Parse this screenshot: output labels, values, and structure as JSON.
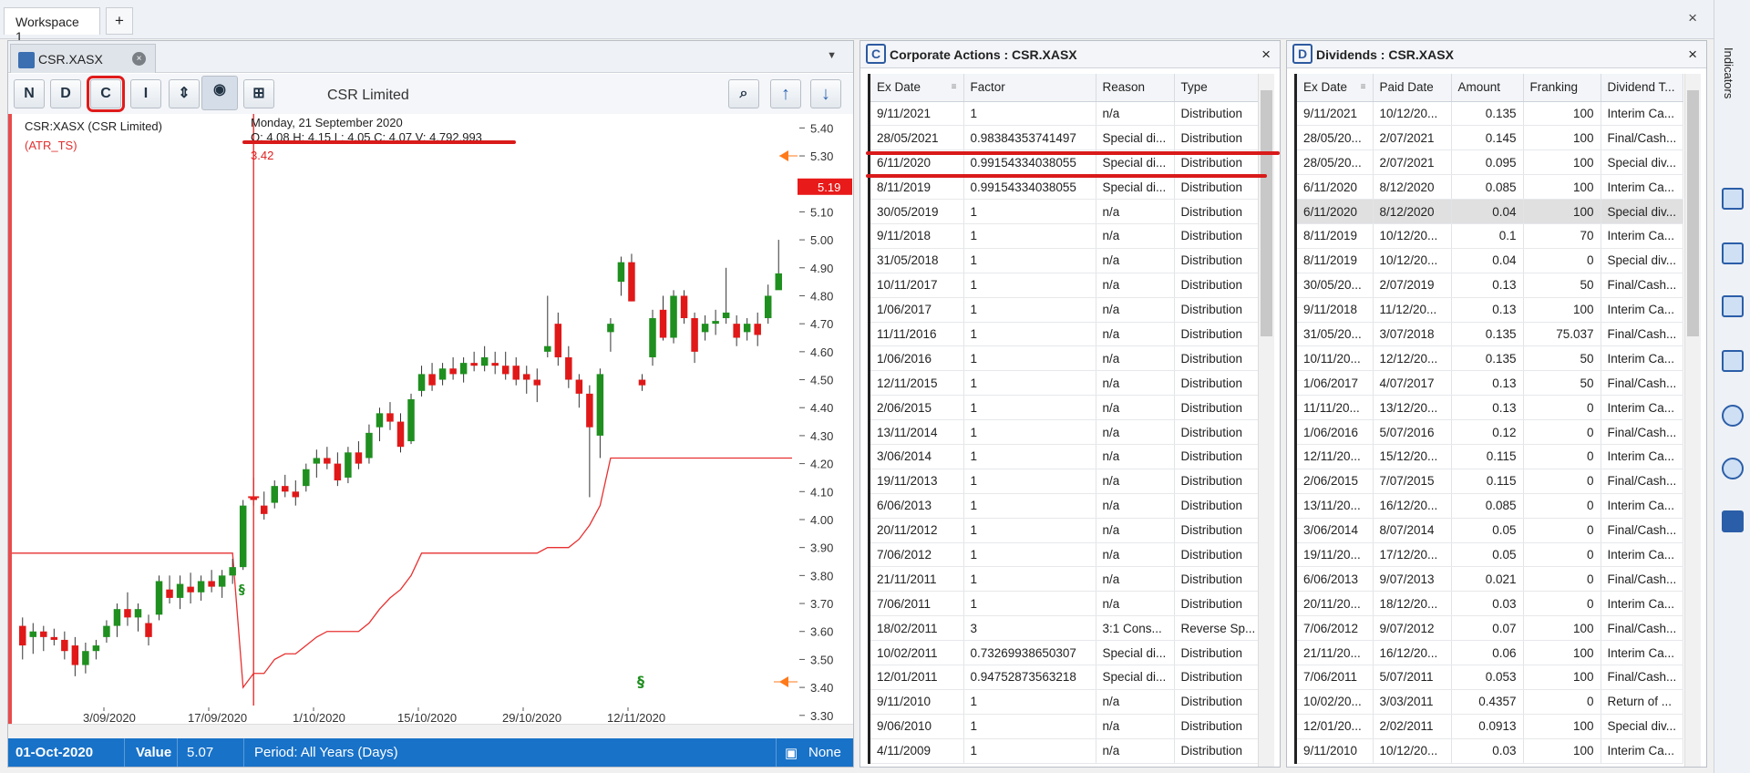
{
  "workspace": {
    "tab": "Workspace 1",
    "add": "+",
    "close": "×"
  },
  "chart": {
    "tab": "CSR.XASX",
    "tab_close": "×",
    "toolbar": {
      "n": "N",
      "d": "D",
      "c": "C",
      "i": "I"
    },
    "security_name": "CSR Limited",
    "legend_symbol": "CSR:XASX (CSR Limited)",
    "legend_indicator": "(ATR_TS)",
    "crosshair_date": "Monday, 21 September 2020",
    "crosshair_ohlc": "O: 4.08  H: 4.15  L: 4.05  C: 4.07  V: 4,792,993",
    "crosshair_value": "3.42",
    "last_price": "5.19",
    "status": {
      "date": "01-Oct-2020",
      "value_label": "Value",
      "value": "5.07",
      "period": "Period: All Years (Days)",
      "none": "None"
    }
  },
  "chart_data": {
    "type": "candlestick",
    "y_ticks": [
      "5.40",
      "5.30",
      "5.20",
      "5.10",
      "5.00",
      "4.90",
      "4.80",
      "4.70",
      "4.60",
      "4.50",
      "4.40",
      "4.30",
      "4.20",
      "4.10",
      "4.00",
      "3.90",
      "3.80",
      "3.70",
      "3.60",
      "3.50",
      "3.40",
      "3.30"
    ],
    "x_ticks": [
      "3/09/2020",
      "17/09/2020",
      "1/10/2020",
      "15/10/2020",
      "29/10/2020",
      "12/11/2020"
    ],
    "ylim": [
      3.27,
      5.45
    ],
    "candles": [
      [
        3.62,
        3.65,
        3.5,
        3.55
      ],
      [
        3.58,
        3.63,
        3.52,
        3.6
      ],
      [
        3.6,
        3.62,
        3.53,
        3.58
      ],
      [
        3.58,
        3.61,
        3.55,
        3.57
      ],
      [
        3.57,
        3.6,
        3.5,
        3.53
      ],
      [
        3.55,
        3.58,
        3.44,
        3.48
      ],
      [
        3.48,
        3.56,
        3.45,
        3.53
      ],
      [
        3.53,
        3.57,
        3.5,
        3.55
      ],
      [
        3.58,
        3.64,
        3.56,
        3.62
      ],
      [
        3.62,
        3.7,
        3.58,
        3.68
      ],
      [
        3.68,
        3.74,
        3.62,
        3.65
      ],
      [
        3.65,
        3.7,
        3.6,
        3.68
      ],
      [
        3.63,
        3.66,
        3.55,
        3.58
      ],
      [
        3.66,
        3.8,
        3.64,
        3.78
      ],
      [
        3.75,
        3.8,
        3.7,
        3.72
      ],
      [
        3.72,
        3.8,
        3.68,
        3.77
      ],
      [
        3.76,
        3.81,
        3.7,
        3.74
      ],
      [
        3.74,
        3.8,
        3.71,
        3.78
      ],
      [
        3.78,
        3.82,
        3.74,
        3.76
      ],
      [
        3.76,
        3.82,
        3.72,
        3.8
      ],
      [
        3.8,
        3.86,
        3.77,
        3.83
      ],
      [
        3.83,
        4.07,
        3.82,
        4.05
      ],
      [
        4.08,
        4.15,
        4.05,
        4.07
      ],
      [
        4.05,
        4.1,
        4.0,
        4.02
      ],
      [
        4.06,
        4.14,
        4.04,
        4.12
      ],
      [
        4.12,
        4.16,
        4.08,
        4.1
      ],
      [
        4.1,
        4.14,
        4.05,
        4.08
      ],
      [
        4.12,
        4.2,
        4.1,
        4.18
      ],
      [
        4.2,
        4.25,
        4.15,
        4.22
      ],
      [
        4.22,
        4.26,
        4.18,
        4.2
      ],
      [
        4.2,
        4.24,
        4.12,
        4.14
      ],
      [
        4.15,
        4.26,
        4.13,
        4.24
      ],
      [
        4.24,
        4.28,
        4.18,
        4.2
      ],
      [
        4.22,
        4.34,
        4.2,
        4.31
      ],
      [
        4.33,
        4.4,
        4.28,
        4.38
      ],
      [
        4.38,
        4.42,
        4.32,
        4.35
      ],
      [
        4.35,
        4.38,
        4.24,
        4.26
      ],
      [
        4.28,
        4.45,
        4.27,
        4.43
      ],
      [
        4.46,
        4.55,
        4.44,
        4.52
      ],
      [
        4.52,
        4.56,
        4.46,
        4.48
      ],
      [
        4.5,
        4.56,
        4.48,
        4.54
      ],
      [
        4.54,
        4.58,
        4.5,
        4.52
      ],
      [
        4.52,
        4.58,
        4.49,
        4.56
      ],
      [
        4.56,
        4.6,
        4.53,
        4.55
      ],
      [
        4.55,
        4.62,
        4.53,
        4.58
      ],
      [
        4.56,
        4.6,
        4.52,
        4.55
      ],
      [
        4.55,
        4.6,
        4.5,
        4.52
      ],
      [
        4.55,
        4.58,
        4.48,
        4.5
      ],
      [
        4.52,
        4.55,
        4.45,
        4.5
      ],
      [
        4.5,
        4.54,
        4.42,
        4.48
      ],
      [
        4.6,
        4.8,
        4.58,
        4.62
      ],
      [
        4.7,
        4.74,
        4.55,
        4.58
      ],
      [
        4.58,
        4.62,
        4.47,
        4.5
      ],
      [
        4.5,
        4.52,
        4.4,
        4.45
      ],
      [
        4.45,
        4.48,
        4.08,
        4.33
      ],
      [
        4.3,
        4.54,
        4.22,
        4.52
      ],
      [
        4.67,
        4.72,
        4.6,
        4.7
      ],
      [
        4.85,
        4.94,
        4.8,
        4.92
      ],
      [
        4.92,
        4.95,
        4.78,
        4.78
      ],
      [
        4.5,
        4.52,
        4.46,
        4.48
      ],
      [
        4.58,
        4.75,
        4.55,
        4.72
      ],
      [
        4.75,
        4.8,
        4.64,
        4.65
      ],
      [
        4.65,
        4.82,
        4.63,
        4.8
      ],
      [
        4.8,
        4.82,
        4.7,
        4.72
      ],
      [
        4.72,
        4.74,
        4.56,
        4.6
      ],
      [
        4.67,
        4.73,
        4.64,
        4.7
      ],
      [
        4.7,
        4.75,
        4.66,
        4.71
      ],
      [
        4.72,
        4.9,
        4.7,
        4.74
      ],
      [
        4.7,
        4.73,
        4.62,
        4.65
      ],
      [
        4.67,
        4.72,
        4.64,
        4.7
      ],
      [
        4.7,
        4.74,
        4.62,
        4.66
      ],
      [
        4.72,
        4.84,
        4.7,
        4.8
      ],
      [
        4.82,
        5.0,
        4.84,
        4.88
      ]
    ],
    "atr_ts": [
      3.88,
      3.88,
      3.88,
      3.88,
      3.88,
      3.88,
      3.88,
      3.88,
      3.88,
      3.88,
      3.88,
      3.88,
      3.88,
      3.88,
      3.88,
      3.88,
      3.88,
      3.88,
      3.88,
      3.88,
      3.88,
      3.4,
      3.45,
      3.45,
      3.5,
      3.52,
      3.52,
      3.55,
      3.58,
      3.6,
      3.6,
      3.6,
      3.6,
      3.63,
      3.68,
      3.72,
      3.75,
      3.8,
      3.88,
      3.88,
      3.88,
      3.88,
      3.88,
      3.88,
      3.88,
      3.88,
      3.88,
      3.88,
      3.88,
      3.88,
      3.9,
      3.9,
      3.9,
      3.93,
      3.98,
      4.05,
      4.22,
      4.22,
      4.22,
      4.22,
      4.22,
      4.22,
      4.22,
      4.22,
      4.22,
      4.22,
      4.22,
      4.22,
      4.22,
      4.22,
      4.22,
      4.22,
      4.22
    ]
  },
  "corp_actions": {
    "title": "Corporate Actions : CSR.XASX",
    "close": "×",
    "columns": [
      "Ex Date",
      "Factor",
      "Reason",
      "Type"
    ],
    "rows": [
      [
        "9/11/2021",
        "1",
        "n/a",
        "Distribution"
      ],
      [
        "28/05/2021",
        "0.98384353741497",
        "Special di...",
        "Distribution"
      ],
      [
        "6/11/2020",
        "0.99154334038055",
        "Special di...",
        "Distribution"
      ],
      [
        "8/11/2019",
        "0.99154334038055",
        "Special di...",
        "Distribution"
      ],
      [
        "30/05/2019",
        "1",
        "n/a",
        "Distribution"
      ],
      [
        "9/11/2018",
        "1",
        "n/a",
        "Distribution"
      ],
      [
        "31/05/2018",
        "1",
        "n/a",
        "Distribution"
      ],
      [
        "10/11/2017",
        "1",
        "n/a",
        "Distribution"
      ],
      [
        "1/06/2017",
        "1",
        "n/a",
        "Distribution"
      ],
      [
        "11/11/2016",
        "1",
        "n/a",
        "Distribution"
      ],
      [
        "1/06/2016",
        "1",
        "n/a",
        "Distribution"
      ],
      [
        "12/11/2015",
        "1",
        "n/a",
        "Distribution"
      ],
      [
        "2/06/2015",
        "1",
        "n/a",
        "Distribution"
      ],
      [
        "13/11/2014",
        "1",
        "n/a",
        "Distribution"
      ],
      [
        "3/06/2014",
        "1",
        "n/a",
        "Distribution"
      ],
      [
        "19/11/2013",
        "1",
        "n/a",
        "Distribution"
      ],
      [
        "6/06/2013",
        "1",
        "n/a",
        "Distribution"
      ],
      [
        "20/11/2012",
        "1",
        "n/a",
        "Distribution"
      ],
      [
        "7/06/2012",
        "1",
        "n/a",
        "Distribution"
      ],
      [
        "21/11/2011",
        "1",
        "n/a",
        "Distribution"
      ],
      [
        "7/06/2011",
        "1",
        "n/a",
        "Distribution"
      ],
      [
        "18/02/2011",
        "3",
        "3:1 Cons...",
        "Reverse Sp..."
      ],
      [
        "10/02/2011",
        "0.73269938650307",
        "Special di...",
        "Distribution"
      ],
      [
        "12/01/2011",
        "0.94752873563218",
        "Special di...",
        "Distribution"
      ],
      [
        "9/11/2010",
        "1",
        "n/a",
        "Distribution"
      ],
      [
        "9/06/2010",
        "1",
        "n/a",
        "Distribution"
      ],
      [
        "4/11/2009",
        "1",
        "n/a",
        "Distribution"
      ]
    ]
  },
  "dividends": {
    "title": "Dividends : CSR.XASX",
    "close": "×",
    "columns": [
      "Ex Date",
      "Paid Date",
      "Amount",
      "Franking",
      "Dividend T..."
    ],
    "rows": [
      [
        "9/11/2021",
        "10/12/20...",
        "0.135",
        "100",
        "Interim Ca..."
      ],
      [
        "28/05/20...",
        "2/07/2021",
        "0.145",
        "100",
        "Final/Cash..."
      ],
      [
        "28/05/20...",
        "2/07/2021",
        "0.095",
        "100",
        "Special div..."
      ],
      [
        "6/11/2020",
        "8/12/2020",
        "0.085",
        "100",
        "Interim Ca..."
      ],
      [
        "6/11/2020",
        "8/12/2020",
        "0.04",
        "100",
        "Special div..."
      ],
      [
        "8/11/2019",
        "10/12/20...",
        "0.1",
        "70",
        "Interim Ca..."
      ],
      [
        "8/11/2019",
        "10/12/20...",
        "0.04",
        "0",
        "Special div..."
      ],
      [
        "30/05/20...",
        "2/07/2019",
        "0.13",
        "50",
        "Final/Cash..."
      ],
      [
        "9/11/2018",
        "11/12/20...",
        "0.13",
        "100",
        "Interim Ca..."
      ],
      [
        "31/05/20...",
        "3/07/2018",
        "0.135",
        "75.037",
        "Final/Cash..."
      ],
      [
        "10/11/20...",
        "12/12/20...",
        "0.135",
        "50",
        "Interim Ca..."
      ],
      [
        "1/06/2017",
        "4/07/2017",
        "0.13",
        "50",
        "Final/Cash..."
      ],
      [
        "11/11/20...",
        "13/12/20...",
        "0.13",
        "0",
        "Interim Ca..."
      ],
      [
        "1/06/2016",
        "5/07/2016",
        "0.12",
        "0",
        "Final/Cash..."
      ],
      [
        "12/11/20...",
        "15/12/20...",
        "0.115",
        "0",
        "Interim Ca..."
      ],
      [
        "2/06/2015",
        "7/07/2015",
        "0.115",
        "0",
        "Final/Cash..."
      ],
      [
        "13/11/20...",
        "16/12/20...",
        "0.085",
        "0",
        "Interim Ca..."
      ],
      [
        "3/06/2014",
        "8/07/2014",
        "0.05",
        "0",
        "Final/Cash..."
      ],
      [
        "19/11/20...",
        "17/12/20...",
        "0.05",
        "0",
        "Interim Ca..."
      ],
      [
        "6/06/2013",
        "9/07/2013",
        "0.021",
        "0",
        "Final/Cash..."
      ],
      [
        "20/11/20...",
        "18/12/20...",
        "0.03",
        "0",
        "Interim Ca..."
      ],
      [
        "7/06/2012",
        "9/07/2012",
        "0.07",
        "100",
        "Final/Cash..."
      ],
      [
        "21/11/20...",
        "16/12/20...",
        "0.06",
        "100",
        "Interim Ca..."
      ],
      [
        "7/06/2011",
        "5/07/2011",
        "0.053",
        "100",
        "Final/Cash..."
      ],
      [
        "10/02/20...",
        "3/03/2011",
        "0.4357",
        "0",
        "Return of ..."
      ],
      [
        "12/01/20...",
        "2/02/2011",
        "0.0913",
        "100",
        "Special div..."
      ],
      [
        "9/11/2010",
        "10/12/20...",
        "0.03",
        "100",
        "Interim Ca..."
      ]
    ]
  },
  "rail": {
    "label": "Indicators"
  }
}
